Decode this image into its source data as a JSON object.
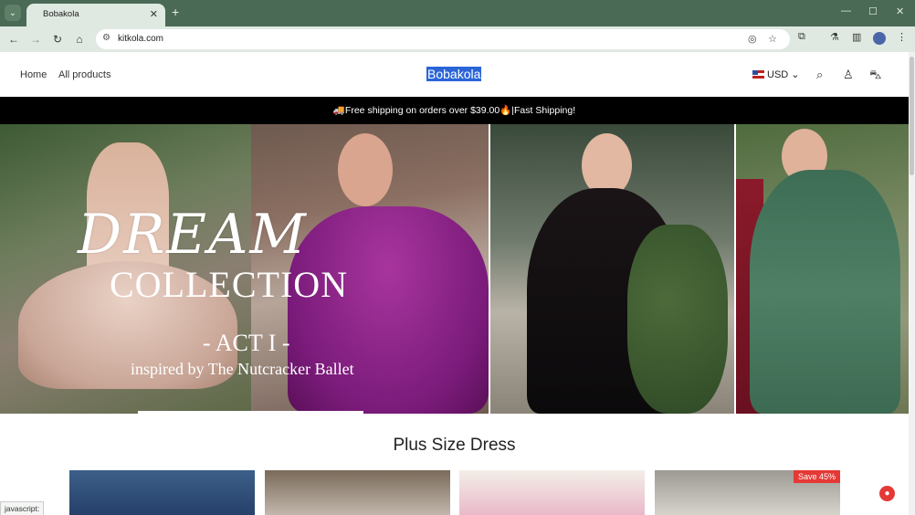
{
  "browser": {
    "tab_title": "Bobakola",
    "url": "kitkola.com",
    "status_text": "javascript:"
  },
  "header": {
    "nav": [
      "Home",
      "All products"
    ],
    "brand": "Bobakola",
    "currency": "USD"
  },
  "announcement": "🚚Free shipping on orders over $39.00🔥|Fast Shipping!",
  "hero": {
    "title_line1": "DREAM",
    "title_line2": "COLLECTION",
    "act": "- ACT I -",
    "subtitle": "inspired by The Nutcracker Ballet"
  },
  "collection": {
    "title": "Plus Size Dress",
    "badge": "Save 45%"
  },
  "colors": {
    "tab_strip": "#4b6a55",
    "toolbar": "#dfe9e2",
    "announcement_bg": "#000000",
    "brand_highlight": "#2a65d8",
    "save_badge": "#e53935"
  }
}
